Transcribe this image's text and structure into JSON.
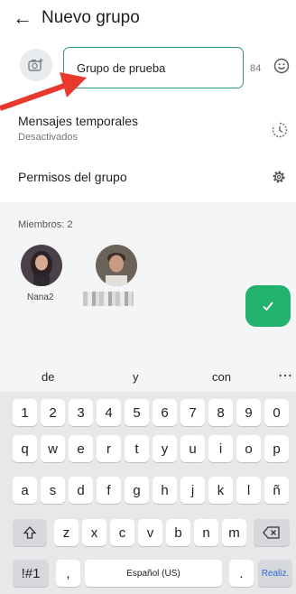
{
  "header": {
    "back_icon": "back-arrow-icon",
    "title": "Nuevo grupo"
  },
  "group": {
    "camera_icon": "camera-add-icon",
    "name_value": "Grupo de prueba",
    "char_counter": "84",
    "emoji_icon": "emoji-icon"
  },
  "settings": {
    "disappearing": {
      "title": "Mensajes temporales",
      "subtitle": "Desactivados",
      "icon": "timer-icon"
    },
    "permissions": {
      "title": "Permisos del grupo",
      "icon": "gear-icon"
    }
  },
  "members": {
    "label": "Miembros: 2",
    "items": [
      {
        "name": "Nana2"
      },
      {
        "name": ""
      }
    ],
    "confirm_icon": "checkmark-icon"
  },
  "keyboard": {
    "suggestions": [
      "de",
      "y",
      "con"
    ],
    "more_icon": "more-horizontal-icon",
    "rows": [
      [
        "1",
        "2",
        "3",
        "4",
        "5",
        "6",
        "7",
        "8",
        "9",
        "0"
      ],
      [
        "q",
        "w",
        "e",
        "r",
        "t",
        "y",
        "u",
        "i",
        "o",
        "p"
      ],
      [
        "a",
        "s",
        "d",
        "f",
        "g",
        "h",
        "j",
        "k",
        "l",
        "ñ"
      ],
      [
        "z",
        "x",
        "c",
        "v",
        "b",
        "n",
        "m"
      ]
    ],
    "shift_icon": "shift-icon",
    "backspace_icon": "backspace-icon",
    "symbols": "!#1",
    "comma": ",",
    "space": "Español (US)",
    "period": ".",
    "action": "Realiz."
  },
  "colors": {
    "accent": "#22b26e",
    "arrow": "#e8392e"
  }
}
